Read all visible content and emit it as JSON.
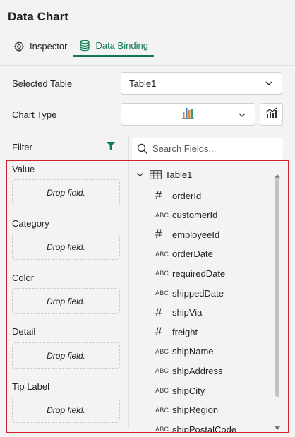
{
  "panel": {
    "title": "Data Chart"
  },
  "tabs": [
    {
      "label": "Inspector",
      "icon": "gear-icon",
      "active": false
    },
    {
      "label": "Data Binding",
      "icon": "database-icon",
      "active": true
    }
  ],
  "selected_table": {
    "label": "Selected Table",
    "value": "Table1"
  },
  "chart_type": {
    "label": "Chart Type",
    "value_icon": "bar-chart-icon"
  },
  "filter": {
    "label": "Filter"
  },
  "search": {
    "placeholder": "Search Fields..."
  },
  "drop_zones": [
    {
      "label": "Value",
      "placeholder": "Drop field."
    },
    {
      "label": "Category",
      "placeholder": "Drop field."
    },
    {
      "label": "Color",
      "placeholder": "Drop field."
    },
    {
      "label": "Detail",
      "placeholder": "Drop field."
    },
    {
      "label": "Tip Label",
      "placeholder": "Drop field."
    }
  ],
  "tree": {
    "table_name": "Table1",
    "type_labels": {
      "text": "ABC",
      "number": "#"
    },
    "fields": [
      {
        "name": "orderId",
        "type": "number"
      },
      {
        "name": "customerId",
        "type": "text"
      },
      {
        "name": "employeeId",
        "type": "number"
      },
      {
        "name": "orderDate",
        "type": "text"
      },
      {
        "name": "requiredDate",
        "type": "text"
      },
      {
        "name": "shippedDate",
        "type": "text"
      },
      {
        "name": "shipVia",
        "type": "number"
      },
      {
        "name": "freight",
        "type": "number"
      },
      {
        "name": "shipName",
        "type": "text"
      },
      {
        "name": "shipAddress",
        "type": "text"
      },
      {
        "name": "shipCity",
        "type": "text"
      },
      {
        "name": "shipRegion",
        "type": "text"
      },
      {
        "name": "shipPostalCode",
        "type": "text"
      }
    ]
  },
  "colors": {
    "accent": "#117a4f",
    "highlight": "#d81e2b"
  }
}
